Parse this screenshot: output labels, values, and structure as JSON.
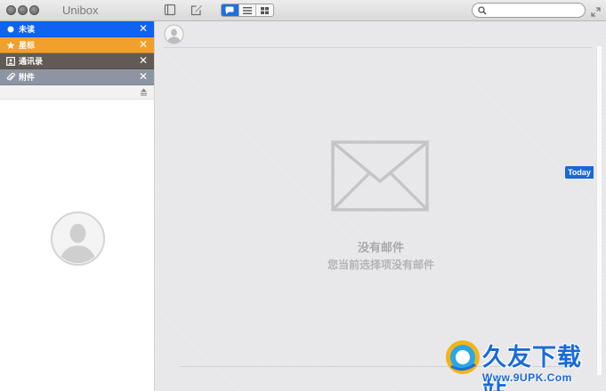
{
  "app": {
    "title": "Unibox"
  },
  "toolbar": {
    "search_placeholder": "",
    "search_value": ""
  },
  "sidebar": {
    "filters": [
      {
        "label": "未读",
        "icon": "dot-icon",
        "color": "#1062f2",
        "close": "✕"
      },
      {
        "label": "星标",
        "icon": "star-icon",
        "color": "#f0a02b",
        "close": "✕"
      },
      {
        "label": "通讯录",
        "icon": "contact-card-icon",
        "color": "#625b55",
        "close": "✕"
      },
      {
        "label": "附件",
        "icon": "paperclip-icon",
        "color": "#8d95a2",
        "close": "✕"
      }
    ]
  },
  "main": {
    "empty_title": "没有邮件",
    "empty_subtitle": "您当前选择项没有邮件",
    "today_badge": "Today"
  },
  "watermark": {
    "text": "久友下载站",
    "url": "Www.9UPK.Com"
  }
}
